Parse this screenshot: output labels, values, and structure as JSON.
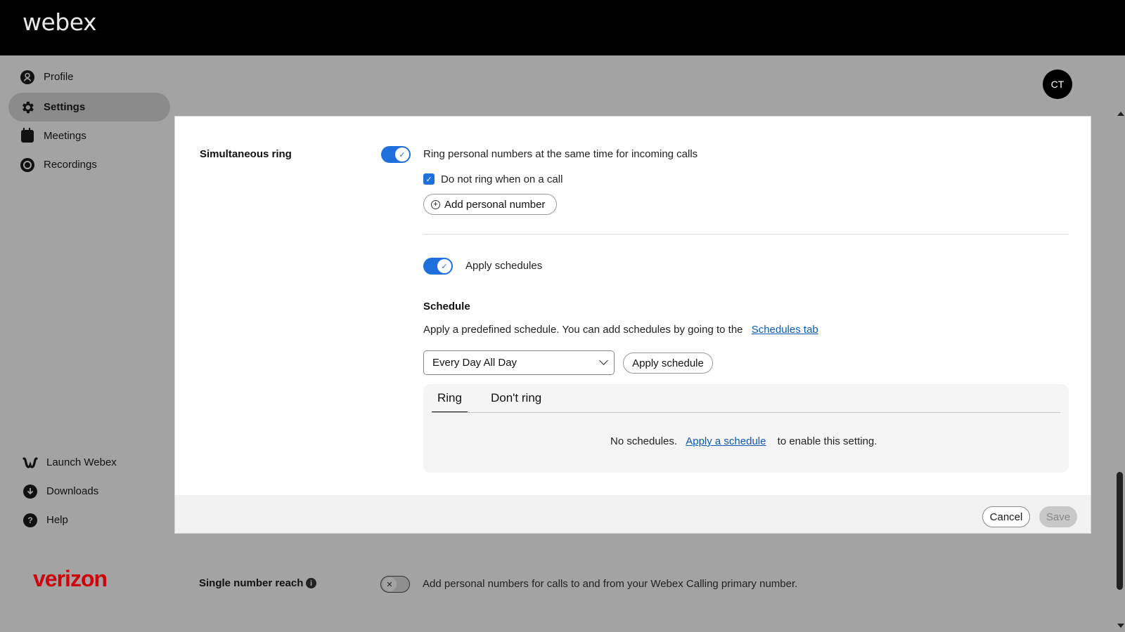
{
  "header": {
    "brand": "webex"
  },
  "sidebar": {
    "items": [
      {
        "label": "Profile",
        "icon": "profile-icon"
      },
      {
        "label": "Settings",
        "icon": "gear-icon",
        "active": true
      },
      {
        "label": "Meetings",
        "icon": "calendar-icon"
      },
      {
        "label": "Recordings",
        "icon": "record-icon"
      }
    ],
    "bottom_items": [
      {
        "label": "Launch Webex",
        "icon": "webex-logo-icon"
      },
      {
        "label": "Downloads",
        "icon": "download-icon"
      },
      {
        "label": "Help",
        "icon": "help-icon"
      }
    ],
    "footer_logo": "verizon"
  },
  "user": {
    "initials": "CT"
  },
  "simultaneous_ring": {
    "title": "Simultaneous ring",
    "toggle_on": true,
    "description": "Ring personal numbers at the same time for incoming calls",
    "checkbox_label": "Do not ring when on a call",
    "checkbox_checked": true,
    "add_number_label": "Add personal number",
    "apply_schedules_label": "Apply schedules",
    "apply_schedules_on": true,
    "schedule": {
      "heading": "Schedule",
      "description": "Apply a predefined schedule. You can add schedules by going to the",
      "link_label": "Schedules tab",
      "selected_value": "Every Day All Day",
      "apply_button_label": "Apply schedule",
      "tabs": [
        "Ring",
        "Don't ring"
      ],
      "active_tab": "Ring",
      "empty_prefix": "No schedules.",
      "empty_link": "Apply a schedule",
      "empty_suffix": "to enable this setting."
    },
    "cancel_label": "Cancel",
    "save_label": "Save"
  },
  "single_number_reach": {
    "title": "Single number reach",
    "toggle_on": false,
    "description": "Add personal numbers for calls to and from your Webex Calling primary number."
  },
  "colors": {
    "accent": "#1f6fdc",
    "link": "#0a5ab5",
    "brand_red": "#cd040b",
    "overlay_gray": "#a3a3a3"
  }
}
